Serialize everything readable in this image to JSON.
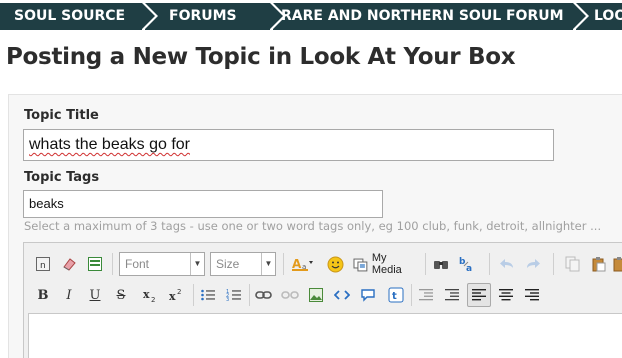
{
  "breadcrumbs": [
    "SOUL SOURCE",
    "FORUMS",
    "RARE AND NORTHERN SOUL FORUM",
    "LOO"
  ],
  "page": {
    "title": "Posting a New Topic in Look At Your Box"
  },
  "form": {
    "topic_title_label": "Topic Title",
    "topic_title_value": "whats the beaks go for",
    "topic_tags_label": "Topic Tags",
    "topic_tags_value": "beaks",
    "tags_hint": "Select a maximum of 3 tags - use one or two word tags only, eg 100 club, funk, detroit, allnighter ..."
  },
  "editor": {
    "font_placeholder": "Font",
    "size_placeholder": "Size",
    "my_media_label": "My Media",
    "format_buttons": [
      "B",
      "I",
      "U",
      "S"
    ],
    "icons": [
      "source-icon",
      "eraser-icon",
      "preview-icon",
      "text-color-icon",
      "smiley-icon",
      "my-media-icon",
      "find-icon",
      "replace-icon",
      "undo-icon",
      "redo-icon",
      "copy-icon",
      "paste-icon",
      "paste-text-icon",
      "subscript-icon",
      "superscript-icon",
      "bullet-list-icon",
      "numbered-list-icon",
      "link-icon",
      "unlink-icon",
      "image-icon",
      "code-icon",
      "quote-icon",
      "twitter-icon",
      "outdent-icon",
      "indent-icon",
      "align-left-icon",
      "align-center-icon",
      "align-right-icon"
    ],
    "colors": {
      "nav_bg": "#1f3e44",
      "accent_orange": "#e39a1b",
      "link_blue": "#2a6fc2"
    }
  }
}
